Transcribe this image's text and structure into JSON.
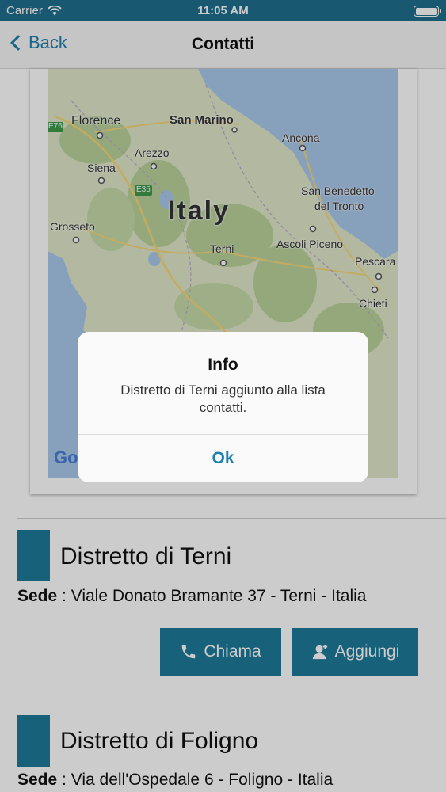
{
  "status_bar": {
    "carrier": "Carrier",
    "time": "11:05 AM",
    "icons": [
      "wifi-icon",
      "battery-icon"
    ]
  },
  "nav": {
    "back_label": "Back",
    "title": "Contatti"
  },
  "map": {
    "labels": {
      "florence": "Florence",
      "san_marino": "San Marino",
      "ancona": "Ancona",
      "arezzo": "Arezzo",
      "siena": "Siena",
      "e35": "E35",
      "e76": "E76",
      "san_benedetto_1": "San Benedetto",
      "san_benedetto_2": "del Tronto",
      "italy": "Italy",
      "grosseto": "Grosseto",
      "terni": "Terni",
      "ascoli": "Ascoli Piceno",
      "pescara": "Pescara",
      "chieti": "Chieti",
      "google": "Go"
    },
    "colors": {
      "land": "#dfe8c8",
      "sea": "#a9c8ec",
      "green": "#b9d39c"
    }
  },
  "contacts": [
    {
      "name": "Distretto di Terni",
      "sede_label": "Sede",
      "sede_value": " : Viale Donato Bramante 37 - Terni - Italia",
      "call_label": "Chiama",
      "add_label": "Aggiungi"
    },
    {
      "name": "Distretto di Foligno",
      "sede_label": "Sede",
      "sede_value": " : Via dell'Ospedale 6 - Foligno - Italia"
    }
  ],
  "alert": {
    "title": "Info",
    "message": "Distretto di Terni aggiunto alla lista contatti.",
    "ok_label": "Ok"
  },
  "colors": {
    "accent": "#1f7a99",
    "link": "#1f7fae",
    "status_bar": "#1f6f8c"
  }
}
